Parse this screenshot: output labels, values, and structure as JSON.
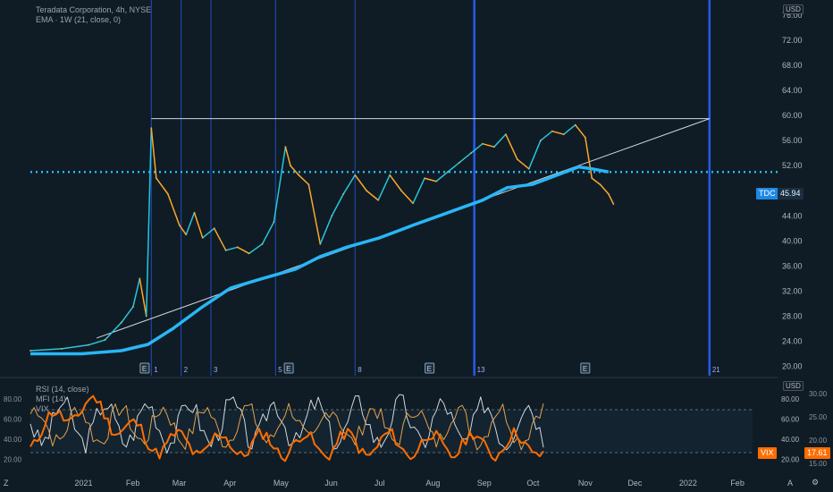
{
  "colors": {
    "background": "#0f1c25",
    "ema": "#29b6f6",
    "price_up": "#26c6da",
    "price_down": "#ffa726",
    "vline": "#2962ff",
    "dotted_level": "#29b6f6",
    "rsi": "#e3a24a",
    "mfi": "#cfd8dc",
    "vix": "#ff6d00"
  },
  "header": {
    "title": "Teradata Corporation, 4h, NYSE",
    "ema_legend": "EMA · 1W (21, close, 0)",
    "currency": "USD"
  },
  "price_tag": {
    "label": "TDC",
    "value": "45.94"
  },
  "lower": {
    "currency": "USD",
    "legend": [
      "RSI (14, close)",
      "MFI (14)",
      "VIX"
    ],
    "vix_tag": {
      "label": "VIX",
      "value": "17.61"
    }
  },
  "bottom": {
    "left_icon": "Z",
    "right_icons": [
      "A",
      "⚙"
    ]
  },
  "event_markers": [
    {
      "kind": "E",
      "pos": "earnings-feb"
    },
    {
      "kind": "1"
    },
    {
      "kind": "2"
    },
    {
      "kind": "3"
    },
    {
      "kind": "5"
    },
    {
      "kind": "E",
      "pos": "earnings-may"
    },
    {
      "kind": "8"
    },
    {
      "kind": "E",
      "pos": "earnings-aug"
    },
    {
      "kind": "13"
    },
    {
      "kind": "E",
      "pos": "earnings-nov"
    },
    {
      "kind": "21"
    }
  ],
  "chart_data": [
    {
      "type": "line",
      "title": "Teradata Corporation, 4h, NYSE",
      "y_axis": {
        "ticks": [
          "20.00",
          "24.00",
          "28.00",
          "32.00",
          "36.00",
          "40.00",
          "44.00",
          "48.00",
          "52.00",
          "56.00",
          "60.00",
          "64.00",
          "68.00",
          "72.00",
          "76.00"
        ],
        "ylim": [
          18.5,
          78
        ]
      },
      "x_axis": {
        "ticks": [
          "2021",
          "Feb",
          "Mar",
          "Apr",
          "May",
          "Jun",
          "Jul",
          "Aug",
          "Sep",
          "Oct",
          "Nov",
          "Dec",
          "2022",
          "Feb"
        ]
      },
      "series": [
        {
          "name": "TDC",
          "x": [
            "2020-12-01",
            "2020-12-20",
            "2021-01-05",
            "2021-01-15",
            "2021-01-25",
            "2021-02-01",
            "2021-02-05",
            "2021-02-09",
            "2021-02-12",
            "2021-02-15",
            "2021-02-22",
            "2021-03-01",
            "2021-03-05",
            "2021-03-10",
            "2021-03-15",
            "2021-03-22",
            "2021-03-29",
            "2021-04-05",
            "2021-04-12",
            "2021-04-20",
            "2021-04-27",
            "2021-05-04",
            "2021-05-07",
            "2021-05-12",
            "2021-05-18",
            "2021-05-25",
            "2021-06-01",
            "2021-06-08",
            "2021-06-15",
            "2021-06-22",
            "2021-06-29",
            "2021-07-06",
            "2021-07-13",
            "2021-07-20",
            "2021-07-27",
            "2021-08-03",
            "2021-08-10",
            "2021-08-17",
            "2021-08-24",
            "2021-08-31",
            "2021-09-07",
            "2021-09-14",
            "2021-09-21",
            "2021-09-28",
            "2021-10-05",
            "2021-10-12",
            "2021-10-19",
            "2021-10-26",
            "2021-11-01",
            "2021-11-05",
            "2021-11-10",
            "2021-11-15",
            "2021-11-18"
          ],
          "values": [
            22.5,
            22.8,
            23.4,
            24.2,
            27.0,
            29.5,
            34.0,
            28.0,
            58.0,
            50.0,
            47.5,
            42.5,
            41.0,
            44.5,
            40.5,
            42.0,
            38.5,
            39.0,
            38.0,
            39.5,
            43.0,
            55.0,
            52.0,
            50.5,
            49.0,
            39.5,
            44.0,
            47.5,
            50.5,
            48.0,
            46.5,
            50.5,
            48.0,
            46.0,
            50.0,
            49.5,
            51.0,
            52.5,
            54.0,
            55.5,
            55.0,
            57.0,
            53.0,
            51.5,
            56.0,
            57.5,
            57.0,
            58.5,
            56.5,
            50.0,
            49.0,
            47.5,
            45.9
          ]
        },
        {
          "name": "EMA",
          "x": [
            "2020-12-01",
            "2021-01-01",
            "2021-01-25",
            "2021-02-10",
            "2021-02-25",
            "2021-03-15",
            "2021-04-01",
            "2021-04-20",
            "2021-05-10",
            "2021-05-25",
            "2021-06-10",
            "2021-06-30",
            "2021-07-20",
            "2021-08-10",
            "2021-08-31",
            "2021-09-15",
            "2021-09-30",
            "2021-10-15",
            "2021-10-28",
            "2021-11-05",
            "2021-11-15"
          ],
          "values": [
            22.0,
            22.0,
            22.5,
            23.5,
            26.0,
            29.5,
            32.5,
            34.0,
            35.5,
            37.5,
            39.0,
            40.5,
            42.5,
            44.5,
            46.5,
            48.5,
            49.0,
            50.5,
            51.8,
            51.5,
            51.0
          ]
        }
      ],
      "annotations": {
        "horizontal_level": 51.0,
        "resistance_line": {
          "from": [
            "2021-02-12",
            59.5
          ],
          "to": [
            "2022-01-15",
            59.5
          ]
        },
        "trend_line": {
          "from": [
            "2021-01-10",
            24.5
          ],
          "to": [
            "2022-01-15",
            59.5
          ]
        },
        "vertical_lines": [
          "2021-02-12",
          "2021-03-02",
          "2021-03-20",
          "2021-04-28",
          "2021-06-15",
          "2021-08-26",
          "2022-01-15"
        ]
      },
      "last_value": 45.94,
      "grid": false
    },
    {
      "type": "line",
      "title": "RSI (14, close) / MFI (14) / VIX",
      "y_axis_left": {
        "ticks": [
          "20.00",
          "40.00",
          "60.00",
          "80.00"
        ],
        "ylim": [
          14,
          96
        ]
      },
      "y_axis_right_inner": {
        "ticks": [
          "20.00",
          "40.00",
          "60.00",
          "80.00"
        ]
      },
      "y_axis_right_outer": {
        "ticks": [
          "15.00",
          "20.00",
          "25.00",
          "30.00"
        ]
      },
      "bands": [
        30,
        70
      ],
      "series": [
        {
          "name": "RSI",
          "summary": "oscillates 30–85 across period, last ≈ 45"
        },
        {
          "name": "MFI",
          "summary": "oscillates 20–90 across period, last ≈ 40"
        },
        {
          "name": "VIX",
          "summary": "spikes to ≈ 35 Jan–Mar, then ranges 16–25, last 17.61"
        }
      ],
      "last_values": {
        "VIX": 17.61
      }
    }
  ]
}
